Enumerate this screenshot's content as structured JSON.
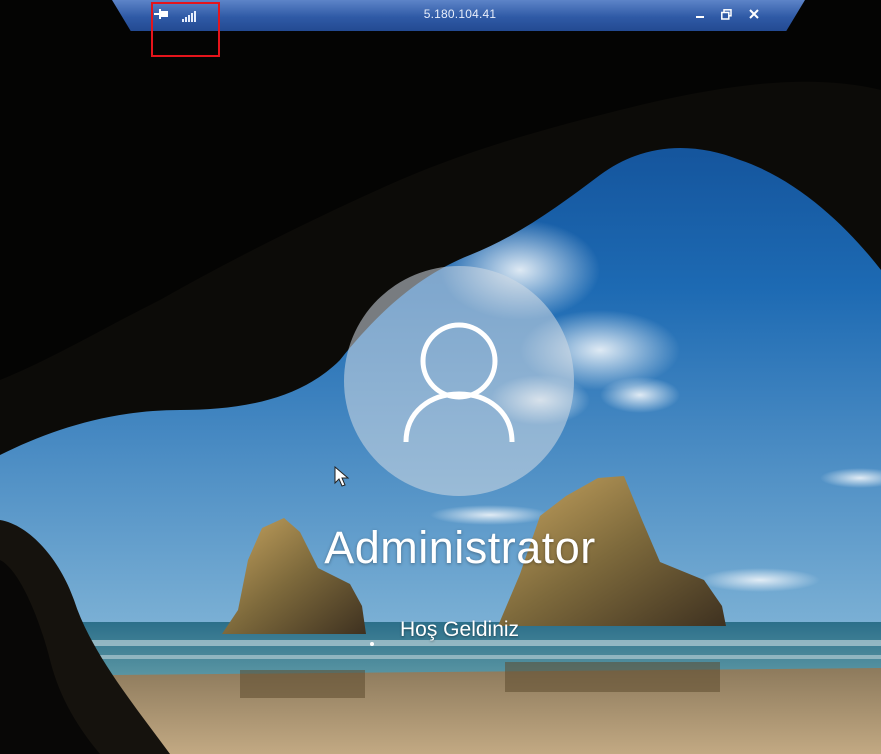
{
  "rdp_bar": {
    "title": "5.180.104.41",
    "pin_icon": "pin-icon",
    "signal_icon": "connection-signal-icon",
    "minimize_icon": "minimize-icon",
    "restore_icon": "restore-icon",
    "close_icon": "close-icon"
  },
  "login": {
    "username": "Administrator",
    "status": "Hoş Geldiniz",
    "avatar_icon": "user-avatar-icon"
  },
  "colors": {
    "rdp_bar": "#2f5aa6",
    "highlight": "#e5141b",
    "text": "#ffffff"
  }
}
